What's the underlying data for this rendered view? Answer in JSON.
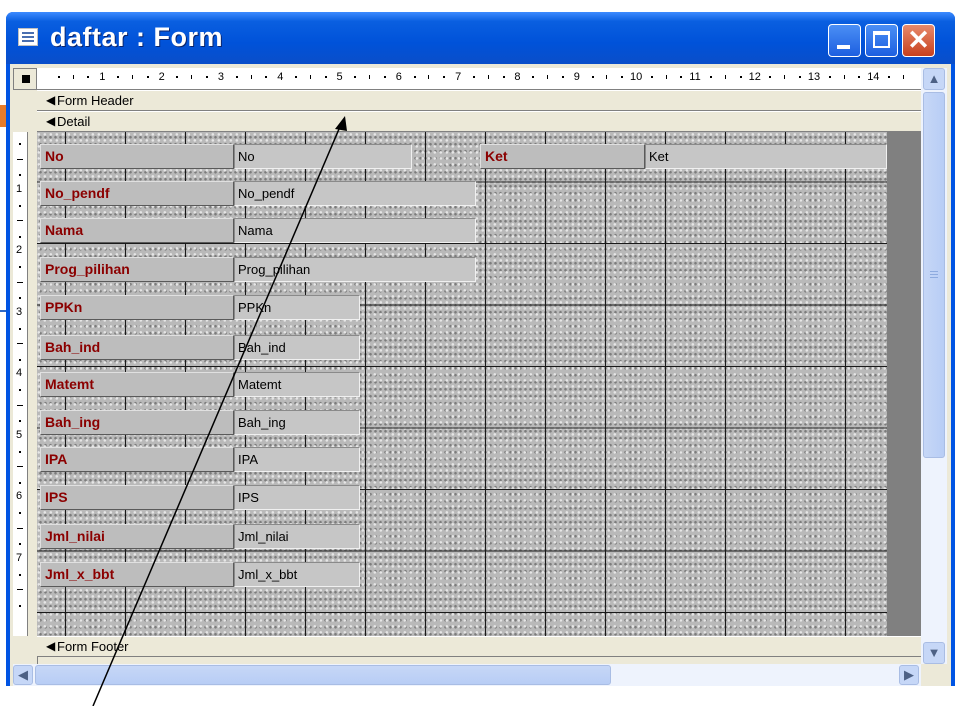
{
  "window": {
    "title": "daftar : Form",
    "buttons": {
      "minimize": "minimize",
      "maximize": "maximize",
      "close": "✕"
    }
  },
  "ruler": {
    "numbers": [
      "1",
      "2",
      "3",
      "4",
      "5",
      "6",
      "7",
      "8",
      "9",
      "10",
      "11",
      "12",
      "13",
      "14"
    ],
    "vertical_numbers": [
      "1",
      "2",
      "3",
      "4",
      "5",
      "6",
      "7"
    ]
  },
  "sections": {
    "header": "Form Header",
    "detail": "Detail",
    "footer": "Form Footer"
  },
  "fields": [
    {
      "label": "No",
      "textbox": "No"
    },
    {
      "label": "No_pendf",
      "textbox": "No_pendf"
    },
    {
      "label": "Nama",
      "textbox": "Nama"
    },
    {
      "label": "Prog_pilihan",
      "textbox": "Prog_pilihan"
    },
    {
      "label": "PPKn",
      "textbox": "PPKn"
    },
    {
      "label": "Bah_ind",
      "textbox": "Bah_ind"
    },
    {
      "label": "Matemt",
      "textbox": "Matemt"
    },
    {
      "label": "Bah_ing",
      "textbox": "Bah_ing"
    },
    {
      "label": "IPA",
      "textbox": "IPA"
    },
    {
      "label": "IPS",
      "textbox": "IPS"
    },
    {
      "label": "Jml_nilai",
      "textbox": "Jml_nilai"
    },
    {
      "label": "Jml_x_bbt",
      "textbox": "Jml_x_bbt"
    }
  ],
  "ket": {
    "label": "Ket",
    "textbox": "Ket"
  },
  "icons": {
    "title": "form-icon",
    "section_marker": "triangle-left-icon",
    "scroll_up": "▲",
    "scroll_down": "▼",
    "scroll_left": "◀",
    "scroll_right": "▶"
  },
  "colors": {
    "titlebar": "#0052d9",
    "label_text": "#8b0000",
    "close_button": "#c7401d"
  }
}
